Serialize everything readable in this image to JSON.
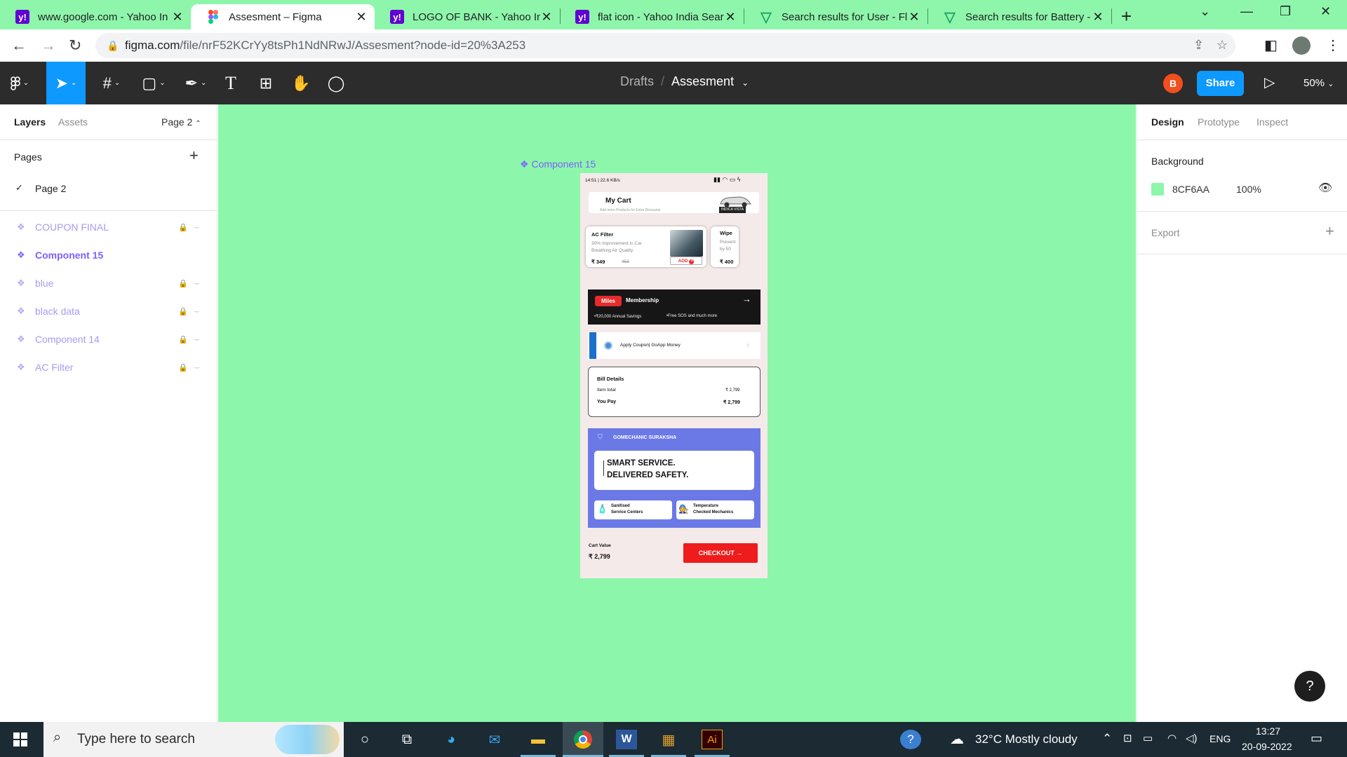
{
  "browser": {
    "tabs": [
      {
        "title": "www.google.com - Yahoo In",
        "icon": "yahoo-icon",
        "active": false
      },
      {
        "title": "Assesment – Figma",
        "icon": "figma-icon",
        "active": true
      },
      {
        "title": "LOGO OF BANK - Yahoo Inc",
        "icon": "yahoo-icon",
        "active": false
      },
      {
        "title": "flat icon - Yahoo India Searc",
        "icon": "yahoo-icon",
        "active": false
      },
      {
        "title": "Search results for User - Fla",
        "icon": "flaticon-icon",
        "active": false
      },
      {
        "title": "Search results for Battery - ",
        "icon": "flaticon-icon",
        "active": false
      }
    ],
    "url_host": "figma.com",
    "url_path": "/file/nrF52KCrYy8tsPh1NdNRwJ/Assesment?node-id=20%3A253"
  },
  "figma": {
    "breadcrumb_drafts": "Drafts",
    "breadcrumb_file": "Assesment",
    "avatar_initial": "B",
    "share_label": "Share",
    "zoom": "50%",
    "left_tabs": {
      "layers": "Layers",
      "assets": "Assets",
      "page_selector": "Page 2"
    },
    "pages_header": "Pages",
    "pages": [
      {
        "name": "Page 2",
        "current": true
      }
    ],
    "layers": [
      {
        "name": "COUPON FINAL",
        "selected": false,
        "locked": true
      },
      {
        "name": "Component 15",
        "selected": true,
        "locked": false
      },
      {
        "name": "blue",
        "selected": false,
        "locked": true
      },
      {
        "name": "black data",
        "selected": false,
        "locked": true
      },
      {
        "name": "Component 14",
        "selected": false,
        "locked": true
      },
      {
        "name": "AC Filter",
        "selected": false,
        "locked": true
      }
    ],
    "frame_label": "Component 15",
    "right_tabs": {
      "design": "Design",
      "prototype": "Prototype",
      "inspect": "Inspect"
    },
    "background_header": "Background",
    "background_hex": "8CF6AA",
    "background_opacity": "100%",
    "export_label": "Export",
    "help_label": "?",
    "canvas_color": "#8cf6aa"
  },
  "phone": {
    "status_time": "14:51 | 22.6 KB/s",
    "mycart_title": "My Cart",
    "mycart_sub": "Add more Products for Extra Discounts",
    "car_label": "INDICA VISTA",
    "product1": {
      "name": "AC Filter",
      "desc1": "30% Improvement in Car",
      "desc2": "Breathing Air Quality",
      "price": "₹ 349",
      "mrp": "453",
      "add": "ADD"
    },
    "product2": {
      "name": "Wipe",
      "desc1": "Prevent",
      "desc2": "by 50",
      "price": "₹ 400"
    },
    "membership": {
      "badge": "Miles",
      "title": "Membership",
      "point1": "•₹20,000 Annual Savings",
      "point2": "•Free SOS and much more"
    },
    "coupon_text": "Apply Coupon| GoApp Money",
    "bill": {
      "title": "Bill Details",
      "item_label": "Item total",
      "item_value": "₹ 2,799",
      "pay_label": "You Pay",
      "pay_value": "₹ 2,799"
    },
    "suraksha": {
      "title": "GOMECHANIC SURAKSHA",
      "line1": "SMART SERVICE.",
      "line2": "DELIVERED SAFETY.",
      "feat1a": "Sanitised",
      "feat1b": "Service Centers",
      "feat2a": "Temperature",
      "feat2b": "Checked Mechanics"
    },
    "cart_value_label": "Cart Value",
    "cart_value": "₹ 2,799",
    "checkout_label": "CHECKOUT"
  },
  "taskbar": {
    "search_placeholder": "Type here to search",
    "weather": "32°C  Mostly cloudy",
    "lang": "ENG",
    "time": "13:27",
    "date": "20-09-2022"
  }
}
